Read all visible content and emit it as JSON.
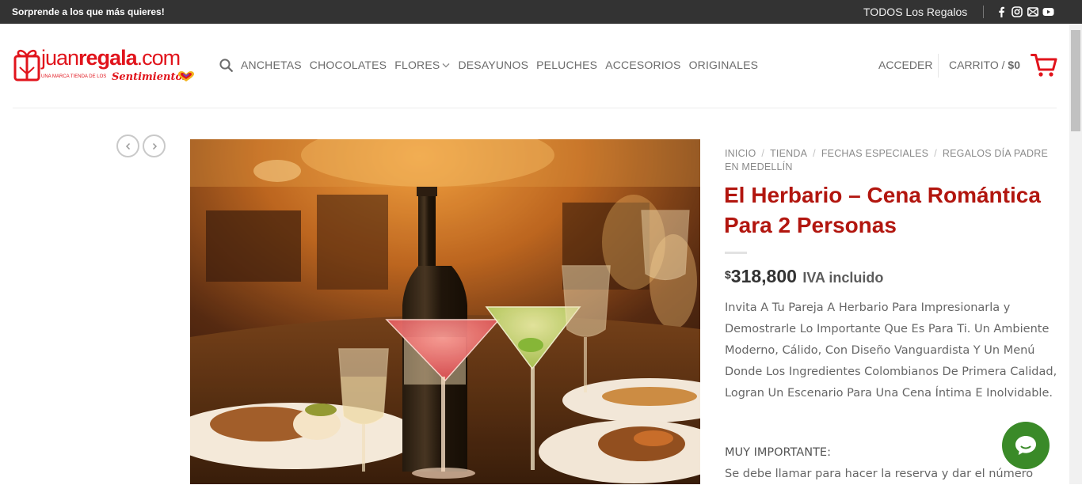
{
  "topbar": {
    "promo": "Sorprende a los que más quieres!",
    "all_gifts": "TODOS Los Regalos",
    "social": [
      "facebook-icon",
      "instagram-icon",
      "email-icon",
      "youtube-icon"
    ]
  },
  "header": {
    "logo": {
      "word_light": "juan",
      "word_bold": "regala",
      "word_suffix": ".com",
      "tagline": "UNA MARCA TIENDA DE LOS",
      "script": "Sentimientos"
    },
    "nav": [
      {
        "label": "ANCHETAS"
      },
      {
        "label": "CHOCOLATES"
      },
      {
        "label": "FLORES"
      },
      {
        "label": "DESAYUNOS"
      },
      {
        "label": "PELUCHES"
      },
      {
        "label": "ACCESORIOS"
      },
      {
        "label": "ORIGINALES"
      }
    ],
    "login": "ACCEDER",
    "cart_label": "CARRITO",
    "cart_sep": "/",
    "cart_total": "$0"
  },
  "product": {
    "breadcrumb": [
      "INICIO",
      "TIENDA",
      "FECHAS ESPECIALES",
      "REGALOS DÍA PADRE EN MEDELLÍN"
    ],
    "breadcrumb_divider": "/",
    "title": "El Herbario – Cena Romántica Para 2 Personas",
    "currency": "$",
    "price": "318,800",
    "tax_note": "IVA incluido",
    "description": "Invita A Tu Pareja A Herbario Para Impresionarla y Demostrarle Lo Importante Que Es Para Ti. Un Ambiente Moderno, Cálido, Con Diseño Vanguardista Y Un Menú Donde Los Ingredientes Colombianos De Primera Calidad, Logran Un Escenario Para Una Cena Íntima E Inolvidable.",
    "important_heading": "MUY IMPORTANTE:",
    "call_note": "Se debe llamar para hacer la reserva y dar el número"
  },
  "colors": {
    "brand_red": "#e1141c",
    "title_red": "#b2160f",
    "topbar_bg": "#333333",
    "chat_green": "#3a8a28"
  }
}
